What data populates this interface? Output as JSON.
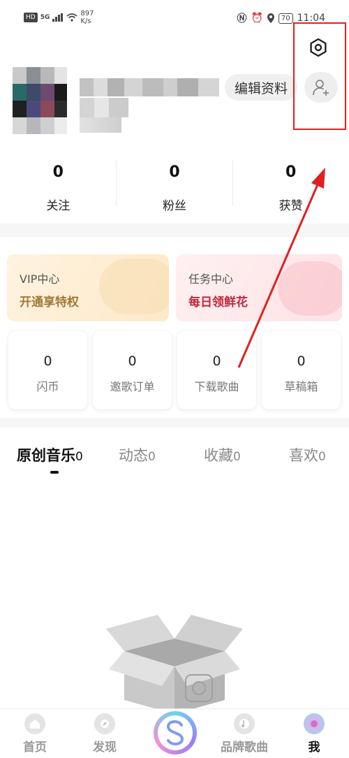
{
  "status_bar": {
    "hd": "HD",
    "signal": "5G",
    "speed_value": "897",
    "speed_unit": "K/s",
    "battery": "70",
    "time": "11:04"
  },
  "profile": {
    "edit_label": "编辑资料"
  },
  "stats": [
    {
      "value": "0",
      "label": "关注"
    },
    {
      "value": "0",
      "label": "粉丝"
    },
    {
      "value": "0",
      "label": "获赞"
    }
  ],
  "cards": {
    "vip": {
      "title": "VIP中心",
      "subtitle": "开通享特权",
      "color": "#a07a3a"
    },
    "task": {
      "title": "任务中心",
      "subtitle": "每日领鲜花",
      "color": "#c0283c"
    }
  },
  "grid": [
    {
      "value": "0",
      "label": "闪币"
    },
    {
      "value": "0",
      "label": "邀歌订单"
    },
    {
      "value": "0",
      "label": "下载歌曲"
    },
    {
      "value": "0",
      "label": "草稿箱"
    }
  ],
  "tabs": [
    {
      "label": "原创音乐",
      "count": "0",
      "active": true
    },
    {
      "label": "动态",
      "count": "0",
      "active": false
    },
    {
      "label": "收藏",
      "count": "0",
      "active": false
    },
    {
      "label": "喜欢",
      "count": "0",
      "active": false
    }
  ],
  "bottom_nav": [
    {
      "label": "首页",
      "icon": "home-icon"
    },
    {
      "label": "发现",
      "icon": "discover-icon"
    },
    {
      "label": "品牌歌曲",
      "icon": "music-note-icon"
    },
    {
      "label": "我",
      "icon": "me-icon",
      "active": true
    }
  ],
  "colors": {
    "annotation_red": "#e02020"
  }
}
